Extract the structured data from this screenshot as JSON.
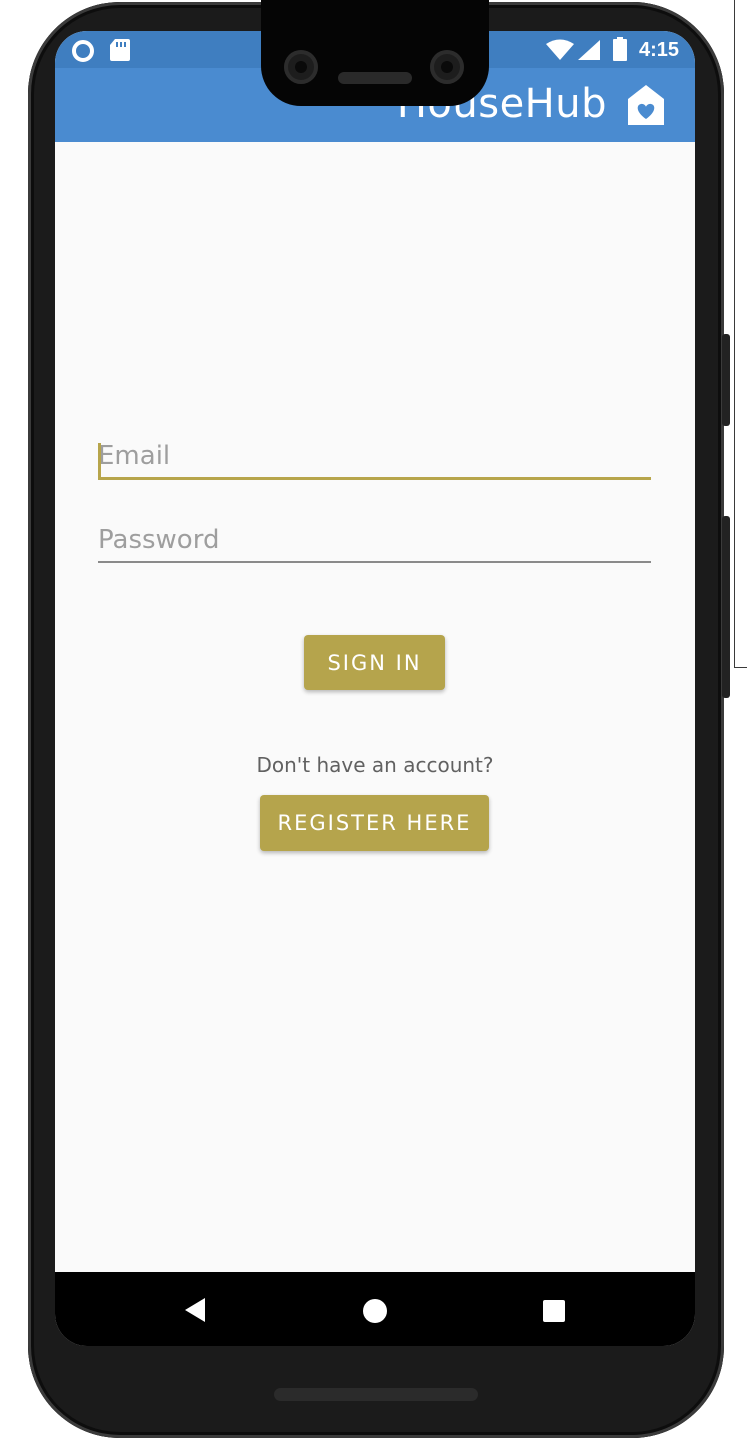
{
  "status_bar": {
    "time": "4:15",
    "icons": [
      "sync-circle-icon",
      "sd-card-icon",
      "wifi-icon",
      "cell-signal-icon",
      "battery-icon"
    ]
  },
  "app_bar": {
    "title": "HouseHub",
    "logo_icon": "house-heart-icon",
    "color": "#4a8bd0"
  },
  "login_form": {
    "email": {
      "placeholder": "Email",
      "value": ""
    },
    "password": {
      "placeholder": "Password",
      "value": ""
    },
    "sign_in_label": "SIGN IN",
    "register_prompt": "Don't have an account?",
    "register_label": "REGISTER HERE",
    "accent_color": "#b5a44c"
  },
  "nav_bar": {
    "icons": [
      "back-icon",
      "home-icon",
      "recents-icon"
    ]
  }
}
